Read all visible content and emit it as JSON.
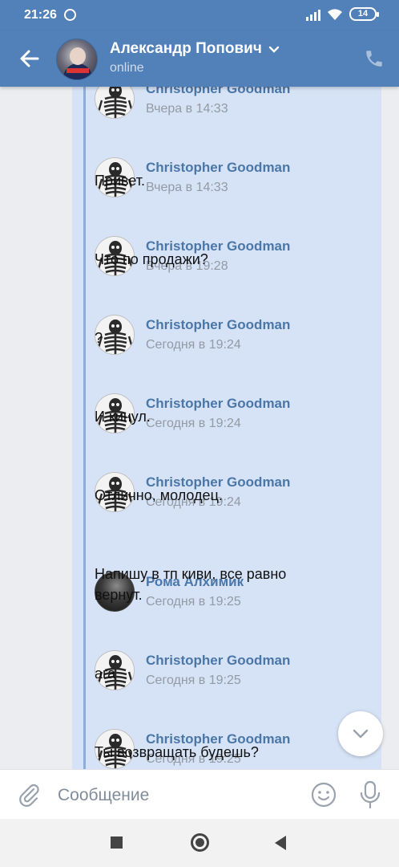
{
  "status_bar": {
    "time": "21:26",
    "battery": "14"
  },
  "header": {
    "contact_name": "Александр Попович",
    "contact_status": "online",
    "accent_color": "#5181b8",
    "icons": [
      "back-arrow-icon",
      "chevron-down-icon",
      "phone-icon"
    ]
  },
  "messages": [
    {
      "author": "Christopher Goodman",
      "time": "Вчера в 14:33",
      "text": "",
      "avatar": "skeleton"
    },
    {
      "author": "Christopher Goodman",
      "time": "Вчера в 14:33",
      "text": "Привет.",
      "avatar": "skeleton"
    },
    {
      "author": "Christopher Goodman",
      "time": "Вчера в 19:28",
      "text": "Что по продажи?",
      "avatar": "skeleton"
    },
    {
      "author": "Christopher Goodman",
      "time": "Сегодня в 19:24",
      "text": "?",
      "avatar": "skeleton"
    },
    {
      "author": "Christopher Goodman",
      "time": "Сегодня в 19:24",
      "text": "И кинул.",
      "avatar": "skeleton"
    },
    {
      "author": "Christopher Goodman",
      "time": "Сегодня в 19:24",
      "text": "Отлично, молодец.",
      "avatar": "skeleton"
    },
    {
      "author": "Рома Алхимик",
      "time": "Сегодня в 19:25",
      "text": "Напишу в тп киви, все равно вернут.",
      "avatar": "dark"
    },
    {
      "author": "Christopher Goodman",
      "time": "Сегодня в 19:25",
      "text": "ага",
      "avatar": "skeleton"
    },
    {
      "author": "Christopher Goodman",
      "time": "Сегодня в 19:25",
      "text": "Ты возвращать будешь?",
      "avatar": "skeleton"
    }
  ],
  "composer": {
    "placeholder": "Сообщение"
  },
  "colors": {
    "name_link": "#4a76a8",
    "forward_background": "#d6e3f6",
    "forward_line": "#8eadd6"
  }
}
